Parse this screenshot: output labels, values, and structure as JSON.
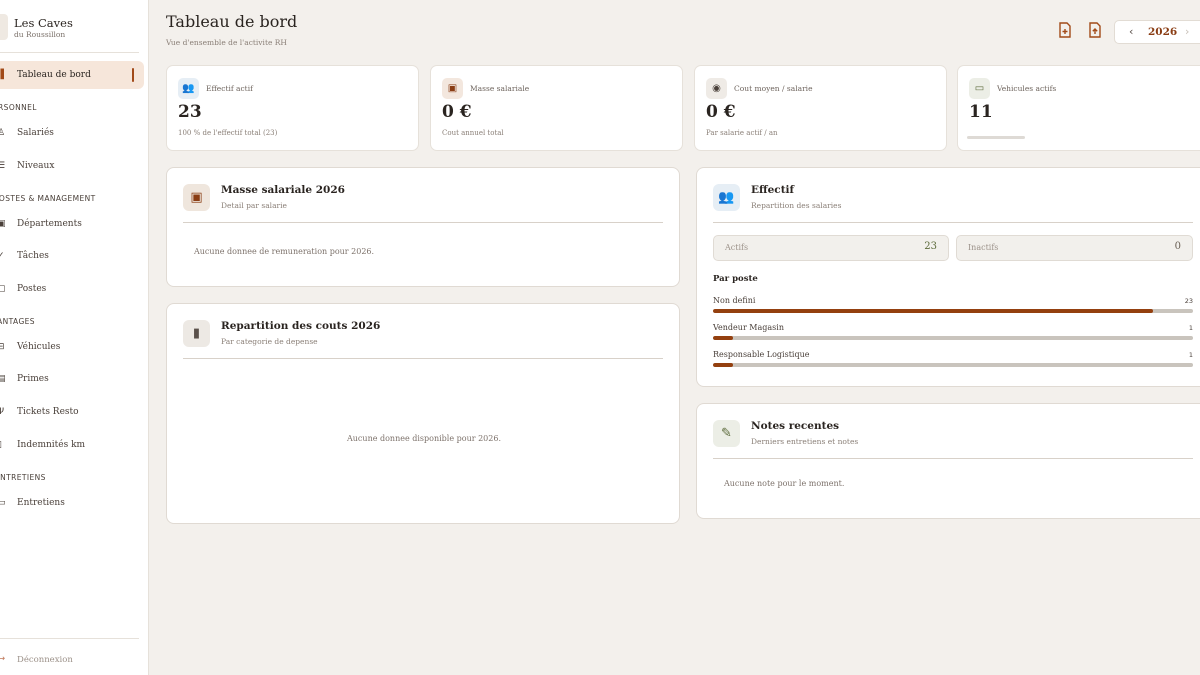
{
  "brand": {
    "name": "Les Caves",
    "subtitle": "du Roussillon"
  },
  "sidebar": {
    "active": {
      "label": "Tableau de bord",
      "icon": "dashboard-icon"
    },
    "sections": [
      {
        "title": "PERSONNEL",
        "items": [
          {
            "label": "Salariés",
            "icon": "user-icon"
          },
          {
            "label": "Niveaux",
            "icon": "levels-icon"
          }
        ]
      },
      {
        "title": "POSTES & MANAGEMENT",
        "items": [
          {
            "label": "Départements",
            "icon": "building-icon"
          },
          {
            "label": "Tâches",
            "icon": "tasks-icon"
          },
          {
            "label": "Postes",
            "icon": "briefcase-icon"
          }
        ]
      },
      {
        "title": "AVANTAGES",
        "items": [
          {
            "label": "Véhicules",
            "icon": "car-icon"
          },
          {
            "label": "Primes",
            "icon": "gift-icon"
          },
          {
            "label": "Tickets Resto",
            "icon": "fork-icon"
          },
          {
            "label": "Indemnités km",
            "icon": "fuel-icon"
          }
        ]
      },
      {
        "title": "ENTRETIENS",
        "items": [
          {
            "label": "Entretiens",
            "icon": "chat-icon"
          }
        ]
      }
    ],
    "logout": "Déconnexion"
  },
  "header": {
    "title": "Tableau de bord",
    "subtitle": "Vue d'ensemble de l'activite RH",
    "year": "2026",
    "export_icon": "file-export-icon",
    "import_icon": "file-upload-icon"
  },
  "kpis": [
    {
      "label": "Effectif actif",
      "value": "23",
      "sub": "100 % de l'effectif total (23)",
      "icon": "users-icon",
      "color": "#3f7aa8",
      "bg": "#e6eef5"
    },
    {
      "label": "Masse salariale",
      "value": "0 €",
      "sub": "Cout annuel total",
      "icon": "wallet-icon",
      "color": "#8a3d14",
      "bg": "#f3e7de"
    },
    {
      "label": "Cout moyen / salarie",
      "value": "0 €",
      "sub": "Par salarie actif / an",
      "icon": "person-icon",
      "color": "#4a403a",
      "bg": "#efebe6"
    },
    {
      "label": "Vehicules actifs",
      "value": "11",
      "sub": "",
      "icon": "car-icon",
      "color": "#5b6a3a",
      "bg": "#eceee6"
    }
  ],
  "panels": {
    "masse": {
      "title": "Masse salariale 2026",
      "subtitle": "Detail par salarie",
      "empty": "Aucune donnee de remuneration pour 2026.",
      "icon": "wallet-icon"
    },
    "couts": {
      "title": "Repartition des couts 2026",
      "subtitle": "Par categorie de depense",
      "empty": "Aucune donnee disponible pour 2026.",
      "icon": "bar-chart-icon"
    },
    "effectif": {
      "title": "Effectif",
      "subtitle": "Repartition des salaries",
      "icon": "users-icon",
      "actifs_label": "Actifs",
      "actifs_value": "23",
      "inactifs_label": "Inactifs",
      "inactifs_value": "0",
      "by_title": "Par poste",
      "postes": [
        {
          "label": "Non defini",
          "count": "23",
          "fraction": 0.917
        },
        {
          "label": "Vendeur Magasin",
          "count": "1",
          "fraction": 0.042
        },
        {
          "label": "Responsable Logistique",
          "count": "1",
          "fraction": 0.042
        }
      ]
    },
    "notes": {
      "title": "Notes recentes",
      "subtitle": "Derniers entretiens et notes",
      "empty": "Aucune note pour le moment.",
      "icon": "note-icon"
    }
  },
  "colors": {
    "accent": "#a24a18",
    "bar_fill": "#94400f",
    "bar_track": "#c9c4bd",
    "background": "#f3f0ec"
  }
}
